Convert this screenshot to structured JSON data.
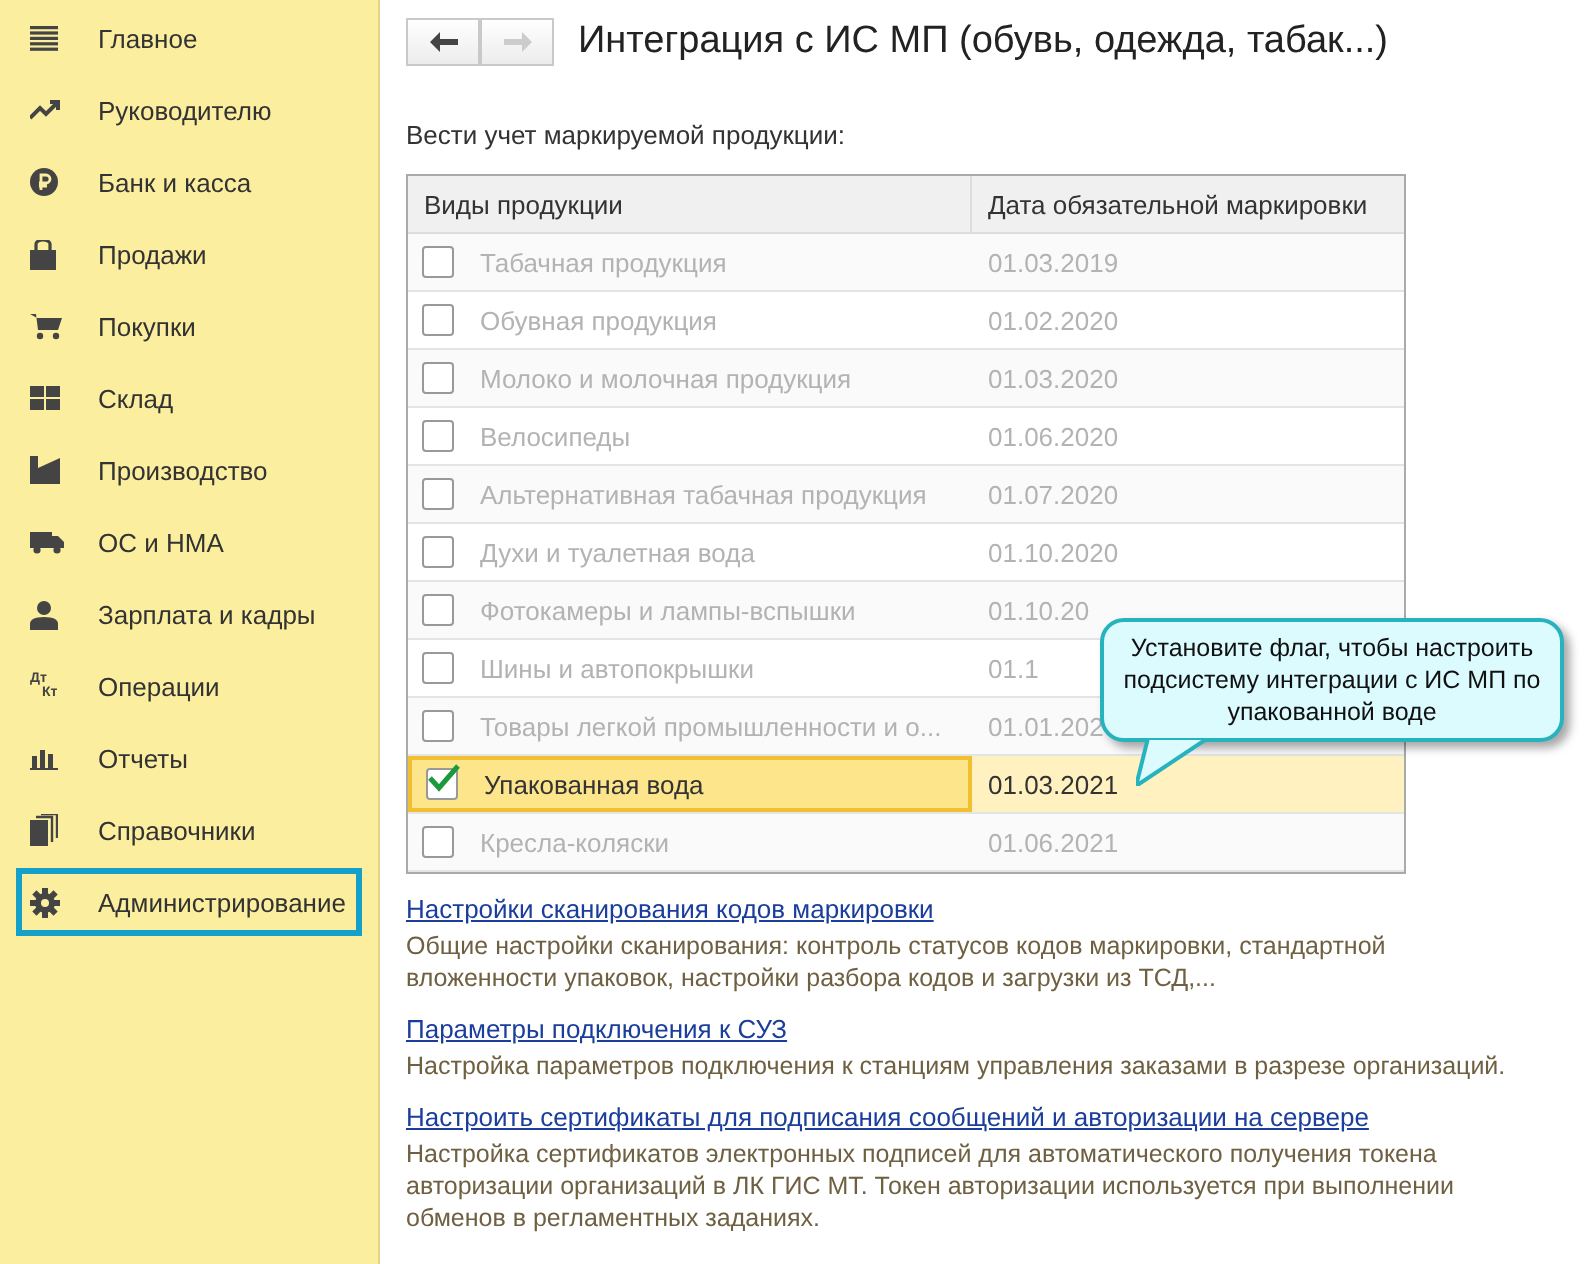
{
  "sidebar": {
    "items": [
      {
        "label": "Главное",
        "selected": false
      },
      {
        "label": "Руководителю",
        "selected": false
      },
      {
        "label": "Банк и касса",
        "selected": false
      },
      {
        "label": "Продажи",
        "selected": false
      },
      {
        "label": "Покупки",
        "selected": false
      },
      {
        "label": "Склад",
        "selected": false
      },
      {
        "label": "Производство",
        "selected": false
      },
      {
        "label": "ОС и НМА",
        "selected": false
      },
      {
        "label": "Зарплата и кадры",
        "selected": false
      },
      {
        "label": "Операции",
        "icon_text": [
          "Дт",
          "Кт"
        ],
        "selected": false
      },
      {
        "label": "Отчеты",
        "selected": false
      },
      {
        "label": "Справочники",
        "selected": false
      },
      {
        "label": "Администрирование",
        "selected": true
      }
    ]
  },
  "title": "Интеграция с ИС МП (обувь, одежда, табак...)",
  "nav": {
    "back_disabled": false,
    "forward_disabled": true
  },
  "section_label": "Вести учет маркируемой продукции:",
  "table": {
    "columns": [
      "Виды продукции",
      "Дата обязательной маркировки"
    ],
    "rows": [
      {
        "name": "Табачная продукция",
        "date": "01.03.2019",
        "checked": false,
        "selected": false
      },
      {
        "name": "Обувная продукция",
        "date": "01.02.2020",
        "checked": false,
        "selected": false
      },
      {
        "name": "Молоко и молочная продукция",
        "date": "01.03.2020",
        "checked": false,
        "selected": false
      },
      {
        "name": "Велосипеды",
        "date": "01.06.2020",
        "checked": false,
        "selected": false
      },
      {
        "name": "Альтернативная табачная продукция",
        "date": "01.07.2020",
        "checked": false,
        "selected": false
      },
      {
        "name": "Духи и туалетная вода",
        "date": "01.10.2020",
        "checked": false,
        "selected": false
      },
      {
        "name": "Фотокамеры и лампы-вспышки",
        "date": "01.10.20",
        "checked": false,
        "selected": false
      },
      {
        "name": "Шины и автопокрышки",
        "date": "01.1",
        "checked": false,
        "selected": false
      },
      {
        "name": "Товары легкой промышленности и о...",
        "date": "01.01.202",
        "checked": false,
        "selected": false
      },
      {
        "name": "Упакованная вода",
        "date": "01.03.2021",
        "checked": true,
        "selected": true
      },
      {
        "name": "Кресла-коляски",
        "date": "01.06.2021",
        "checked": false,
        "selected": false
      }
    ]
  },
  "callout": "Установите флаг, чтобы настроить подсистему интеграции с ИС МП по упакованной воде",
  "links": [
    {
      "link": "Настройки сканирования кодов маркировки",
      "description": "Общие настройки сканирования: контроль статусов кодов маркировки, стандартной вложенности упаковок, настройки разбора кодов и загрузки из ТСД,..."
    },
    {
      "link": "Параметры подключения к СУЗ",
      "description": "Настройка параметров подключения к станциям управления заказами в разрезе организаций."
    },
    {
      "link": "Настроить сертификаты для подписания сообщений и авторизации на сервере",
      "description": "Настройка сертификатов электронных подписей для автоматического получения токена авторизации организаций в ЛК ГИС МТ. Токен авторизации используется при выполнении обменов в регламентных заданиях."
    }
  ]
}
